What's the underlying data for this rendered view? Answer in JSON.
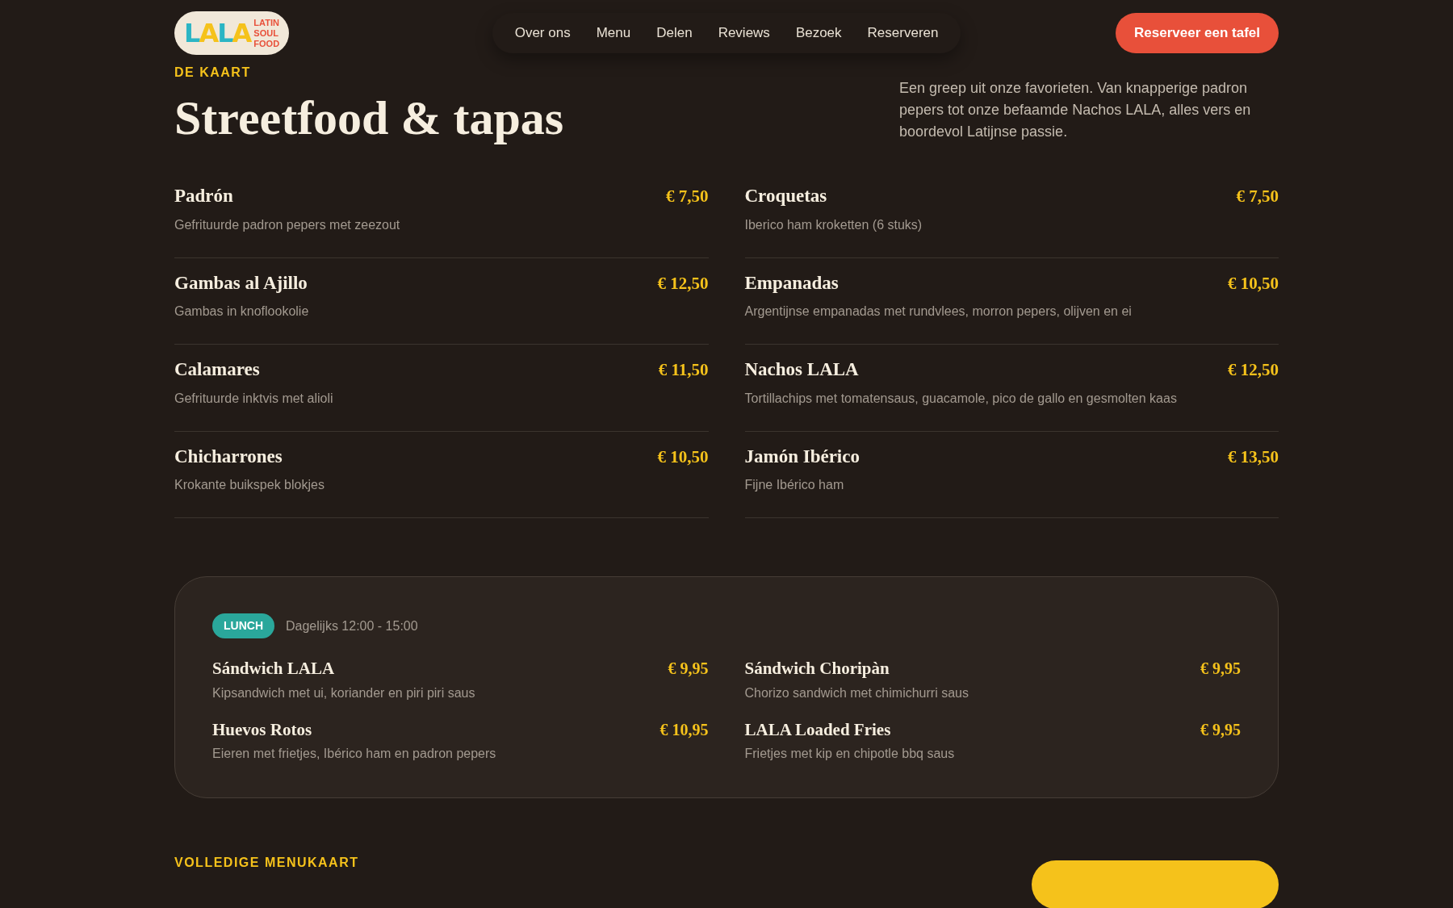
{
  "header": {
    "logo": {
      "wordmark": "LALA",
      "tagline": [
        "LATIN",
        "SOUL",
        "FOOD"
      ]
    },
    "nav": [
      "Over ons",
      "Menu",
      "Delen",
      "Reviews",
      "Bezoek",
      "Reserveren"
    ],
    "cta": "Reserveer een tafel"
  },
  "menu_section": {
    "eyebrow": "DE KAART",
    "title": "Streetfood & tapas",
    "intro": "Een greep uit onze favorieten. Van knapperige padron pepers tot onze befaamde Nachos LALA, alles vers en boordevol Latijnse passie.",
    "items": [
      {
        "name": "Padrón",
        "price": "€ 7,50",
        "description": "Gefrituurde padron pepers met zeezout"
      },
      {
        "name": "Croquetas",
        "price": "€ 7,50",
        "description": "Iberico ham kroketten (6 stuks)"
      },
      {
        "name": "Gambas al Ajillo",
        "price": "€ 12,50",
        "description": "Gambas in knoflookolie"
      },
      {
        "name": "Empanadas",
        "price": "€ 10,50",
        "description": "Argentijnse empanadas met rundvlees, morron pepers, olijven en ei"
      },
      {
        "name": "Calamares",
        "price": "€ 11,50",
        "description": "Gefrituurde inktvis met alioli"
      },
      {
        "name": "Nachos LALA",
        "price": "€ 12,50",
        "description": "Tortillachips met tomatensaus, guacamole, pico de gallo en gesmolten kaas"
      },
      {
        "name": "Chicharrones",
        "price": "€ 10,50",
        "description": "Krokante buikspek blokjes"
      },
      {
        "name": "Jamón Ibérico",
        "price": "€ 13,50",
        "description": "Fijne Ibérico ham"
      }
    ]
  },
  "lunch": {
    "badge": "LUNCH",
    "hours": "Dagelijks 12:00 - 15:00",
    "items": [
      {
        "name": "Sándwich LALA",
        "price": "€ 9,95",
        "description": "Kipsandwich met ui, koriander en piri piri saus"
      },
      {
        "name": "Sándwich Choripàn",
        "price": "€ 9,95",
        "description": "Chorizo sandwich met chimichurri saus"
      },
      {
        "name": "Huevos Rotos",
        "price": "€ 10,95",
        "description": "Eieren met frietjes, Ibérico ham en padron pepers"
      },
      {
        "name": "LALA Loaded Fries",
        "price": "€ 9,95",
        "description": "Frietjes met kip en chipotle bbq saus"
      }
    ]
  },
  "full_menu": {
    "eyebrow": "VOLLEDIGE MENUKAART"
  }
}
